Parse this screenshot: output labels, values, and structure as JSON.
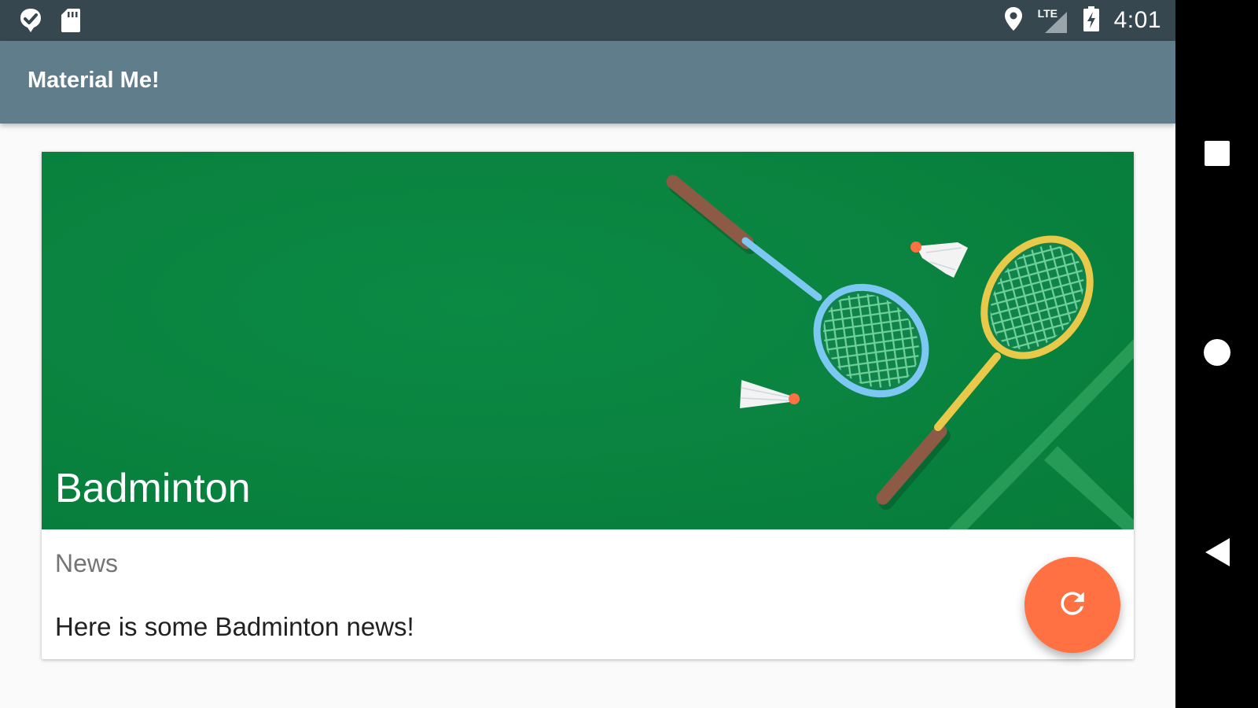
{
  "status_bar": {
    "time": "4:01",
    "network_label": "LTE",
    "icons": [
      "notification-app-icon",
      "sd-card-icon",
      "location-pin-icon",
      "signal-lte-icon",
      "battery-charging-icon"
    ]
  },
  "app_bar": {
    "title": "Material Me!",
    "background": "#607d8b"
  },
  "card": {
    "image_name": "badminton-court-illustration",
    "title": "Badminton",
    "subtitle": "News",
    "body": "Here is some Badminton news!"
  },
  "fab": {
    "icon": "refresh-icon",
    "color": "#ff7043"
  },
  "nav_bar": {
    "buttons": [
      "recents-square-icon",
      "home-circle-icon",
      "back-triangle-icon"
    ]
  },
  "colors": {
    "status_bar": "#37474f",
    "court_green": "#0a8440",
    "racket_blue": "#7cc8f2",
    "racket_yellow": "#e8c94a",
    "shuttle_tip": "#ff7043"
  }
}
